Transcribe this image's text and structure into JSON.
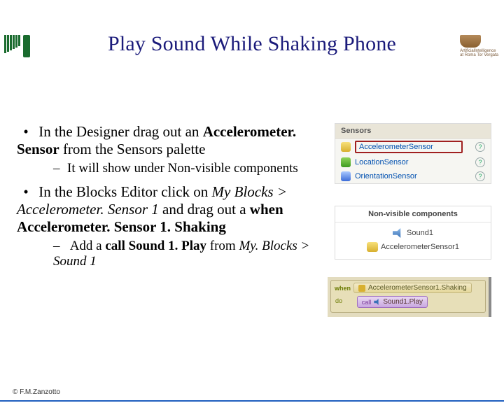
{
  "header": {
    "right_logo_line1": "ArtificialIntelligence",
    "right_logo_line2": "at Roma Tor Vergata"
  },
  "title": "Play Sound While Shaking Phone",
  "bullets": {
    "b1_pre": "In the Designer drag out an ",
    "b1_strong": "Accelerometer. Sensor",
    "b1_post": " from the Sensors palette",
    "b1_sub": "It will show under Non-visible components",
    "b2_pre": "In the Blocks Editor click on ",
    "b2_em": "My Blocks > Accelerometer. Sensor 1",
    "b2_mid": " and drag out a ",
    "b2_strong": "when Accelerometer. Sensor 1. Shaking",
    "b2_sub_pre": "Add a ",
    "b2_sub_strong": "call Sound 1. Play",
    "b2_sub_mid": " from ",
    "b2_sub_em": "My. Blocks > Sound 1"
  },
  "sensors": {
    "header": "Sensors",
    "item1": "AccelerometerSensor",
    "item2": "LocationSensor",
    "item3": "OrientationSensor",
    "q": "?"
  },
  "nonvis": {
    "header": "Non-visible components",
    "item1": "Sound1",
    "item2": "AccelerometerSensor1"
  },
  "blocks": {
    "when": "when",
    "event": "AccelerometerSensor1.Shaking",
    "do": "do",
    "call": "call",
    "action": "Sound1.Play"
  },
  "footer": "© F.M.Zanzotto"
}
